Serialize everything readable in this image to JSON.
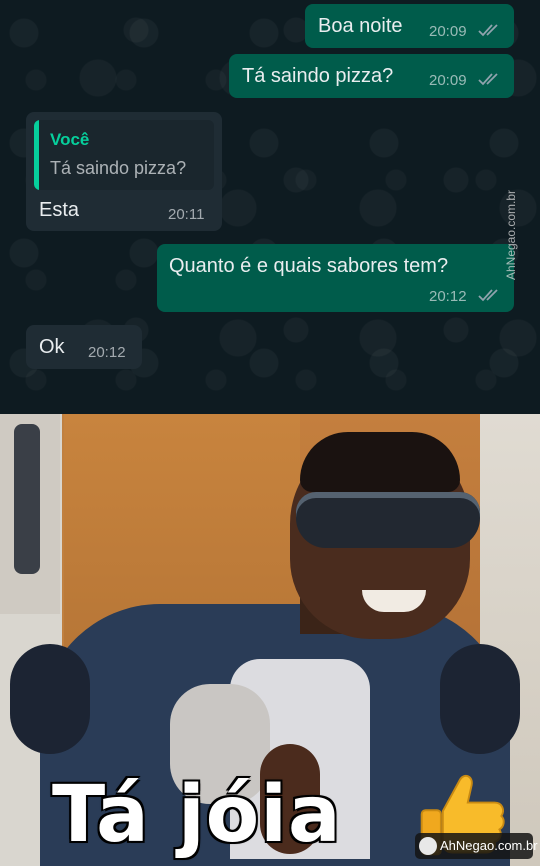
{
  "messages": [
    {
      "direction": "outgoing",
      "text": "Boa noite",
      "time": "20:09",
      "status": "read"
    },
    {
      "direction": "outgoing",
      "text": "Tá saindo pizza?",
      "time": "20:09",
      "status": "read"
    },
    {
      "direction": "incoming",
      "quote": {
        "author": "Você",
        "text": "Tá saindo pizza?"
      },
      "text": "Esta",
      "time": "20:11"
    },
    {
      "direction": "outgoing",
      "text": "Quanto é e quais sabores tem?",
      "time": "20:12",
      "status": "read"
    },
    {
      "direction": "incoming",
      "text": "Ok",
      "time": "20:12"
    }
  ],
  "watermark_side": "AhNegao.com.br",
  "meme": {
    "caption": "Tá jóia",
    "emoji": "thumbs-up-icon",
    "watermark": "AhNegao.com.br"
  },
  "colors": {
    "outgoing_bubble": "#005c4b",
    "incoming_bubble": "#1f2c34",
    "quote_accent": "#06cf9c",
    "chat_background": "#0e1b21"
  }
}
